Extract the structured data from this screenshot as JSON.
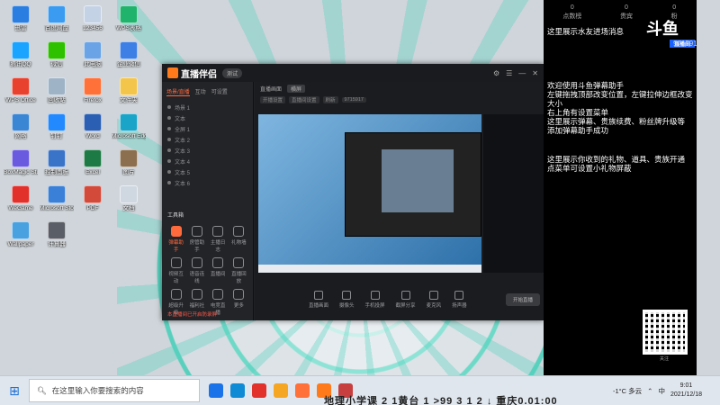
{
  "desktop": {
    "icons": [
      {
        "label": "迅雷",
        "color": "#2a7de1"
      },
      {
        "label": "百度网盘",
        "color": "#3a9bf0"
      },
      {
        "label": "123456",
        "color": "#c4d2e6"
      },
      {
        "label": "WPS表格",
        "color": "#1fb36b"
      },
      {
        "label": "腾讯QQ",
        "color": "#1aa3ff"
      },
      {
        "label": "微信",
        "color": "#2dc100"
      },
      {
        "label": "此电脑",
        "color": "#6aa4e6"
      },
      {
        "label": "企业微信",
        "color": "#3d7fe5"
      },
      {
        "label": "WPS Office",
        "color": "#e8412e"
      },
      {
        "label": "回收站",
        "color": "#9fb3c7"
      },
      {
        "label": "Firefox",
        "color": "#ff7139"
      },
      {
        "label": "文件夹",
        "color": "#f3c64b"
      },
      {
        "label": "网络",
        "color": "#3b86d4"
      },
      {
        "label": "钉钉",
        "color": "#2389ff"
      },
      {
        "label": "Word",
        "color": "#2b5fb4"
      },
      {
        "label": "Microsoft Edge",
        "color": "#1aa5c8"
      },
      {
        "label": "BoxMagic Studio",
        "color": "#6a5ae0"
      },
      {
        "label": "控制面板",
        "color": "#3a74c9"
      },
      {
        "label": "Excel",
        "color": "#1e7a44"
      },
      {
        "label": "图片",
        "color": "#8b6f4e"
      },
      {
        "label": "WeGame",
        "color": "#e2302b"
      },
      {
        "label": "Microsoft Store",
        "color": "#3a80d8"
      },
      {
        "label": "PDF",
        "color": "#d34a3a"
      },
      {
        "label": "文档",
        "color": "#cfd7e0"
      },
      {
        "label": "Wallpaper",
        "color": "#49a1e0"
      },
      {
        "label": "计算器",
        "color": "#5a5e66"
      }
    ]
  },
  "app": {
    "title": "直播伴侣",
    "badge": "测试",
    "sidebar_tabs": [
      "场景/直播",
      "互动",
      "可设置"
    ],
    "scenes": [
      "场景 1",
      "文本",
      "全屏 1",
      "文本 2",
      "文本 3",
      "文本 4",
      "文本 5",
      "文本 6"
    ],
    "tools_title": "工具箱",
    "tools": [
      "弹幕助手",
      "房管助手",
      "主播日志",
      "礼物墙",
      "视频互动",
      "语音连线",
      "直播间",
      "直播回放",
      "超级升级",
      "福利社",
      "电竞直播",
      "更多"
    ],
    "footer": "本直播间已开启防录屏",
    "main_tab": "直播画面",
    "main_pill": "横屏",
    "sub_tabs": [
      "开播设置",
      "直播间设置",
      "刷新",
      "9715917"
    ],
    "controls": [
      "直播画面",
      "摄像头",
      "手机投屏",
      "截屏分享",
      "麦克风",
      "扬声器"
    ],
    "start_label": "开始直播"
  },
  "panel": {
    "stats": [
      {
        "label": "点数榜",
        "value": "0"
      },
      {
        "label": "贵宾",
        "value": "0"
      },
      {
        "label": "粉",
        "value": "0"
      }
    ],
    "brand": "斗鱼",
    "brand_sub": "直播间",
    "room": "971591",
    "lines_a": [
      "这里展示水友进场消息"
    ],
    "lines_b": [
      "欢迎使用斗鱼弹幕助手",
      "左键拖拽顶部改变位置，左键拉伸边框改变大小",
      "右上角有设置菜单",
      "这里展示弹幕、贵族续费、粉丝牌升级等",
      "添加弹幕助手成功"
    ],
    "lines_c": [
      "这里展示你收到的礼物、道具、贵族开通",
      "点菜单可设置小礼物屏蔽"
    ],
    "qr_label": "关注"
  },
  "taskbar": {
    "search_placeholder": "在这里输入你要搜索的内容",
    "weather": "-1°C 多云",
    "time": "9:01",
    "date": "2021/12/18",
    "ime": "中",
    "ticker": "地理小学课  2  1黄台  1  >99 3 1 2  ↓  重庆0.01:00"
  }
}
